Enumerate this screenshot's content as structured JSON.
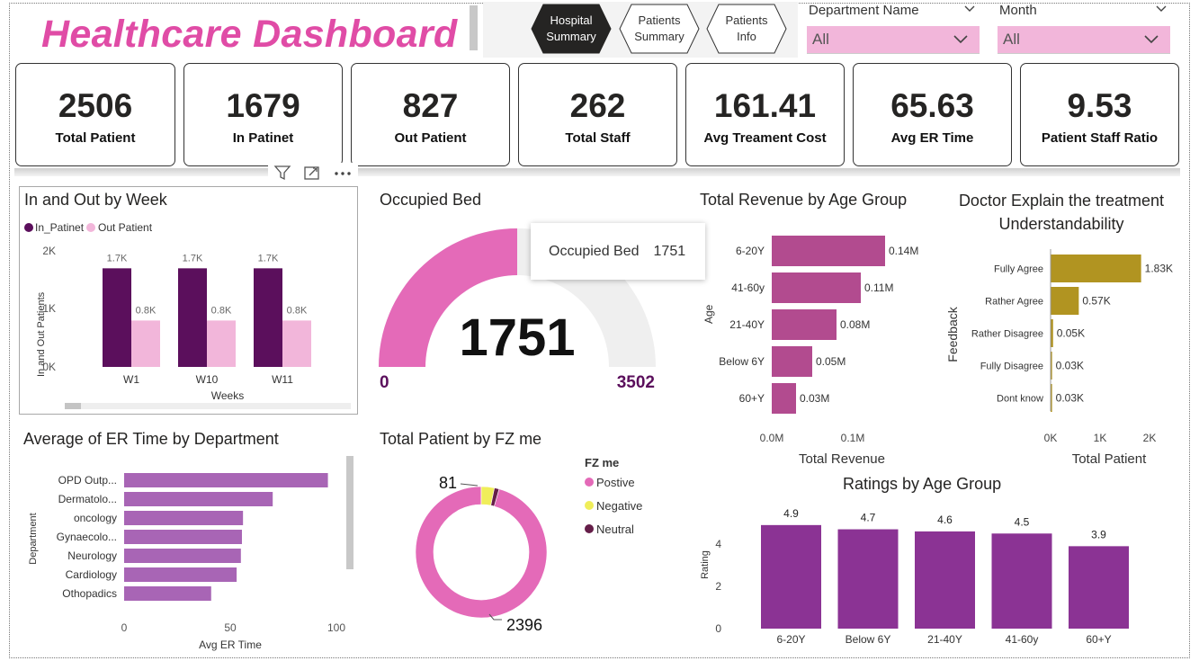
{
  "header": {
    "title": "Healthcare Dashboard",
    "nav": [
      "Hospital Summary",
      "Patients Summary",
      "Patients Info"
    ],
    "active_nav": 0,
    "slicers": [
      {
        "label": "Department Name",
        "value": "All"
      },
      {
        "label": "Month",
        "value": "All"
      }
    ]
  },
  "cards": [
    {
      "value": "2506",
      "label": "Total Patient"
    },
    {
      "value": "1679",
      "label": "In Patinet"
    },
    {
      "value": "827",
      "label": "Out Patient"
    },
    {
      "value": "262",
      "label": "Total Staff"
    },
    {
      "value": "161.41",
      "label": "Avg Treament Cost"
    },
    {
      "value": "65.63",
      "label": "Avg ER Time"
    },
    {
      "value": "9.53",
      "label": "Patient Staff Ratio"
    }
  ],
  "colors": {
    "brand_pink": "#e04ca6",
    "in_patient": "#5b0f5c",
    "out_patient": "#f2b6da",
    "gauge_fill": "#e46ab8",
    "gauge_track": "#efefef",
    "revenue_bar": "#b24b8f",
    "feedback_bar": "#b19421",
    "er_bar": "#a865b5",
    "rating_bar": "#8b3394",
    "neutral": "#651e49",
    "negative": "#f0ee5a"
  },
  "visual_header_icons": [
    "filter-icon",
    "focus-mode-icon",
    "more-options-icon"
  ],
  "chart_data": [
    {
      "id": "in_out_by_week",
      "type": "bar",
      "title": "In and Out by Week",
      "xlabel": "Weeks",
      "ylabel": "In and Out Patients",
      "categories": [
        "W1",
        "W10",
        "W11"
      ],
      "series": [
        {
          "name": "In_Patinet",
          "values": [
            1700,
            1700,
            1700
          ],
          "labels": [
            "1.7K",
            "1.7K",
            "1.7K"
          ]
        },
        {
          "name": "Out Patient",
          "values": [
            800,
            800,
            800
          ],
          "labels": [
            "0.8K",
            "0.8K",
            "0.8K"
          ]
        }
      ],
      "yticks": [
        "0K",
        "1K",
        "2K"
      ],
      "ylim": [
        0,
        2000
      ],
      "legend": "top-left",
      "has_scrollbar": true
    },
    {
      "id": "occupied_bed",
      "type": "gauge",
      "title": "Occupied Bed",
      "value": 1751,
      "value_label": "1751",
      "min": 0,
      "min_label": "0",
      "max": 3502,
      "max_label": "3502",
      "tooltip": {
        "label": "Occupied Bed",
        "value": "1751"
      }
    },
    {
      "id": "revenue_by_age",
      "type": "bar",
      "orientation": "horizontal",
      "title": "Total Revenue by Age Group",
      "xlabel": "Total Revenue",
      "ylabel": "Age",
      "categories": [
        "6-20Y",
        "41-60y",
        "21-40Y",
        "Below 6Y",
        "60+Y"
      ],
      "values": [
        140000,
        110000,
        80000,
        50000,
        30000
      ],
      "labels": [
        "0.14M",
        "0.11M",
        "0.08M",
        "0.05M",
        "0.03M"
      ],
      "xticks": [
        "0.0M",
        "0.1M"
      ],
      "xlim": [
        0,
        150000
      ]
    },
    {
      "id": "doctor_explain",
      "type": "bar",
      "orientation": "horizontal",
      "title": "Doctor Explain the treatment Understandability",
      "xlabel": "Total Patient",
      "ylabel": "Feedback",
      "categories": [
        "Fully Agree",
        "Rather Agree",
        "Rather Disagree",
        "Fully Disagree",
        "Dont know"
      ],
      "values": [
        1830,
        570,
        50,
        30,
        30
      ],
      "labels": [
        "1.83K",
        "0.57K",
        "0.05K",
        "0.03K",
        "0.03K"
      ],
      "xticks": [
        "0K",
        "1K",
        "2K"
      ],
      "xlim": [
        0,
        2000
      ]
    },
    {
      "id": "er_time_by_department",
      "type": "bar",
      "orientation": "horizontal",
      "title": "Average of ER Time by Department",
      "xlabel": "Avg ER Time",
      "ylabel": "Department",
      "categories": [
        "OPD Outp...",
        "Dermatolo...",
        "oncology",
        "Gynaecolo...",
        "Neurology",
        "Cardiology",
        "Othopadics"
      ],
      "values": [
        96,
        70,
        56,
        55.5,
        55,
        53,
        41
      ],
      "xticks": [
        "0",
        "50",
        "100"
      ],
      "xlim": [
        0,
        100
      ],
      "has_scrollbar": true
    },
    {
      "id": "patient_by_fz_me",
      "type": "pie",
      "title": "Total Patient by FZ me",
      "legend_title": "FZ me",
      "legend": "right",
      "slices": [
        {
          "name": "Postive",
          "value": 2396,
          "label": "2396"
        },
        {
          "name": "Negative",
          "value": 81,
          "label": "81"
        },
        {
          "name": "Neutral",
          "value": 29
        }
      ]
    },
    {
      "id": "ratings_by_age",
      "type": "bar",
      "title": "Ratings by Age Group",
      "xlabel": "",
      "ylabel": "Rating",
      "categories": [
        "6-20Y",
        "Below 6Y",
        "21-40Y",
        "41-60y",
        "60+Y"
      ],
      "values": [
        4.9,
        4.7,
        4.6,
        4.5,
        3.9
      ],
      "labels": [
        "4.9",
        "4.7",
        "4.6",
        "4.5",
        "3.9"
      ],
      "yticks": [
        "0",
        "2",
        "4"
      ],
      "ylim": [
        0,
        5.2
      ]
    }
  ]
}
